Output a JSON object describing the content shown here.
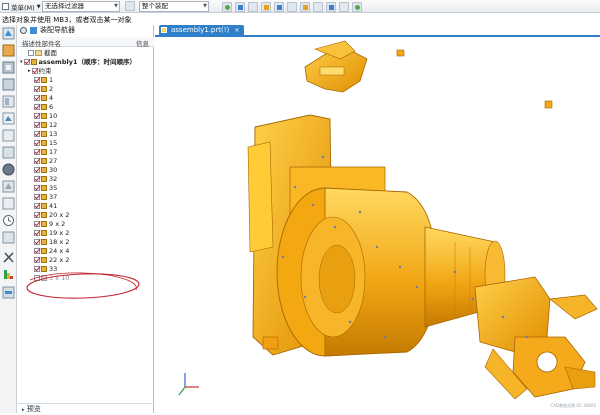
{
  "toolbar": {
    "menu_label": "菜单(M)",
    "filter_select": "无选择过滤器",
    "scope_select": "整个装配"
  },
  "hint": "选择对象并使用 MB3，或者双击某一对象",
  "navigator": {
    "title": "装配导航器",
    "col_name": "描述性部件名",
    "col_info": "信息",
    "rows": [
      {
        "label": "截面",
        "checked": false,
        "type": "folder",
        "indent": 1
      },
      {
        "label": "assembly1（顺序：时间顺序）",
        "checked": true,
        "type": "assembly",
        "indent": 0
      },
      {
        "label": "约束",
        "checked": true,
        "type": "constraint",
        "indent": 1
      },
      {
        "label": "1",
        "checked": true,
        "type": "part",
        "indent": 1
      },
      {
        "label": "2",
        "checked": true,
        "type": "part",
        "indent": 1
      },
      {
        "label": "4",
        "checked": true,
        "type": "part",
        "indent": 1
      },
      {
        "label": "6",
        "checked": true,
        "type": "part",
        "indent": 1
      },
      {
        "label": "10",
        "checked": true,
        "type": "part",
        "indent": 1
      },
      {
        "label": "12",
        "checked": true,
        "type": "part",
        "indent": 1
      },
      {
        "label": "13",
        "checked": true,
        "type": "part",
        "indent": 1
      },
      {
        "label": "15",
        "checked": true,
        "type": "part",
        "indent": 1
      },
      {
        "label": "17",
        "checked": true,
        "type": "part",
        "indent": 1
      },
      {
        "label": "27",
        "checked": true,
        "type": "part",
        "indent": 1
      },
      {
        "label": "30",
        "checked": true,
        "type": "part",
        "indent": 1
      },
      {
        "label": "32",
        "checked": true,
        "type": "part",
        "indent": 1
      },
      {
        "label": "35",
        "checked": true,
        "type": "part",
        "indent": 1
      },
      {
        "label": "37",
        "checked": true,
        "type": "part",
        "indent": 1
      },
      {
        "label": "41",
        "checked": true,
        "type": "part",
        "indent": 1
      },
      {
        "label": "20 x 2",
        "checked": true,
        "type": "part",
        "indent": 1
      },
      {
        "label": "9 x 2",
        "checked": true,
        "type": "part",
        "indent": 1
      },
      {
        "label": "19 x 2",
        "checked": true,
        "type": "part",
        "indent": 1
      },
      {
        "label": "18 x 2",
        "checked": true,
        "type": "part",
        "indent": 1
      },
      {
        "label": "24 x 4",
        "checked": true,
        "type": "part",
        "indent": 1
      },
      {
        "label": "22 x 2",
        "checked": true,
        "type": "part",
        "indent": 1
      },
      {
        "label": "33",
        "checked": true,
        "type": "part",
        "indent": 1
      },
      {
        "label": "3 x 10",
        "checked": false,
        "type": "part-grey",
        "indent": 1
      }
    ]
  },
  "preview_label": "预览",
  "document_tab": {
    "label": "assembly1.prt(!)",
    "close": "×"
  },
  "watermark": "CAD数据交换 ID: 30600",
  "colors": {
    "part_orange": "#f2a716",
    "part_edge": "#b87300",
    "annotation_red": "#c0262d",
    "tab_blue": "#2f7fc9"
  }
}
